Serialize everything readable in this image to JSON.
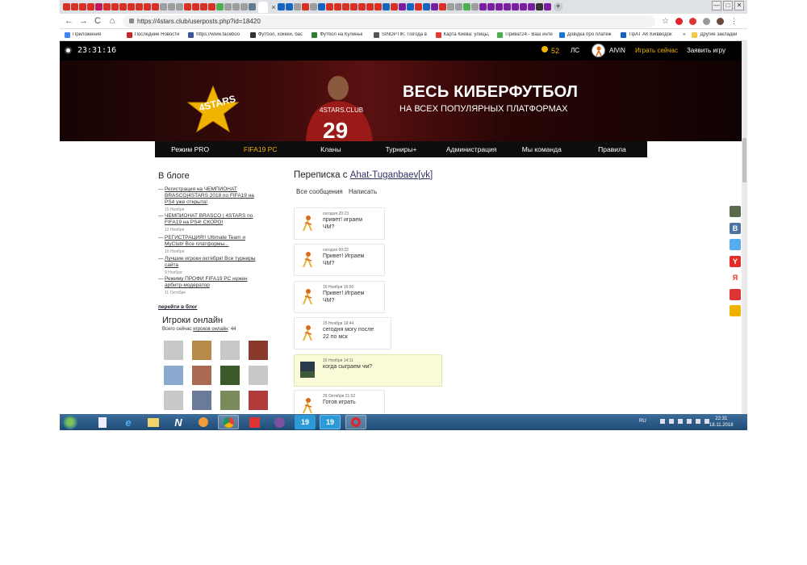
{
  "browser": {
    "url": "https://4stars.club/userposts.php?id=18420",
    "tab_close": "×",
    "new_tab": "+",
    "window_controls": [
      "—",
      "□",
      "✕"
    ],
    "nav": {
      "back": "←",
      "forward": "→",
      "reload": "C",
      "home": "⌂"
    },
    "bookmarks": [
      "Приложения",
      "Последние Новости",
      "https://www.faceboo",
      "Футбол, хоккей, бас",
      "Футбол на Кулиньк",
      "SINOPTIK: Погода в",
      "Карта Киева: улицы,",
      "Приват24 - Ваш инте",
      "Довідка про платеж",
      "ПрАТ АК Київводок"
    ],
    "bookmarks_more": "»",
    "other_bookmarks": "Другие закладки"
  },
  "site": {
    "clock": "23:31:16",
    "coins": "52",
    "pm": "ЛС",
    "user": "AlViN",
    "play_now": "Играть сейчас",
    "claim": "Заявить игру",
    "banner_title": "ВЕСЬ КИБЕРФУТБОЛ",
    "banner_sub": "НА ВСЕХ ПОПУЛЯРНЫХ ПЛАТФОРМАХ",
    "logo": "4STARS",
    "logo_tag": "Уважаем соперника / Уважаем игру",
    "shirt": "4STARS.CLUB",
    "nav": [
      "Режим PRO",
      "FIFA19 PC",
      "Кланы",
      "Турниры+",
      "Администрация",
      "Мы команда",
      "Правила"
    ],
    "active_nav": "FIFA19 PC"
  },
  "blog": {
    "heading": "В блоге",
    "posts": [
      {
        "title": "Регистрация на ЧЕМПИОНАТ BRASCO|4STARS 2018 по FIFA19 на PS4 уже открыта!",
        "date": "15 Ноября"
      },
      {
        "title": "ЧЕМПИОНАТ BRASCO | 4STARS по FIFA19 на PS4! СКОРО!",
        "date": "12 Ноября"
      },
      {
        "title": "РЕГИСТРАЦИЯ!! Ultimate Team и MyClub! Все платформы...",
        "date": "10 Ноября"
      },
      {
        "title": "Лучшие игроки октября! Все турниры сайта",
        "date": "9 Ноября"
      },
      {
        "title": "Режиму ПРОФИ FIFA19 PC нужен арбитр-модератор",
        "date": "11 Октября"
      }
    ],
    "more": "перейти в блог"
  },
  "online": {
    "heading": "Игроки онлайн",
    "count_prefix": "Всего сейчас",
    "count_link": "игроков онлайн",
    "count_suffix": ": 44",
    "avatars": 12
  },
  "conversation": {
    "title_prefix": "Переписка с",
    "partner": "Ahat-Tuganbaev[vk]",
    "tabs": [
      "Все сообщения",
      "Написать"
    ],
    "messages": [
      {
        "date": "сегодня 20:23",
        "text": [
          "привет! играем",
          "ЧМ?"
        ],
        "own": false
      },
      {
        "date": "сегодня 00:22",
        "text": [
          "Привет! Играем",
          "ЧМ?"
        ],
        "own": false
      },
      {
        "date": "16 Ноября 16:00",
        "text": [
          "Привет! Играем",
          "ЧМ?"
        ],
        "own": false
      },
      {
        "date": "15 Ноября 19:44",
        "text": [
          "сегодня могу после",
          "22 по мск"
        ],
        "own": false
      },
      {
        "date": "15 Ноября 14:11",
        "text": [
          "когда сыграем чм?"
        ],
        "own": true
      },
      {
        "date": "29 Октября 21:52",
        "text": [
          "Готов играть"
        ],
        "own": false
      }
    ]
  },
  "share": [
    "В",
    "Y",
    "Я"
  ],
  "taskbar": {
    "apps": [
      "N",
      "19",
      "19"
    ],
    "lang": "RU",
    "time": "22:31",
    "date": "18.11.2018"
  },
  "colors": {
    "accent": "#f0b400",
    "nav_bg": "#0d0d0d",
    "own_msg": "#fbfad8"
  }
}
